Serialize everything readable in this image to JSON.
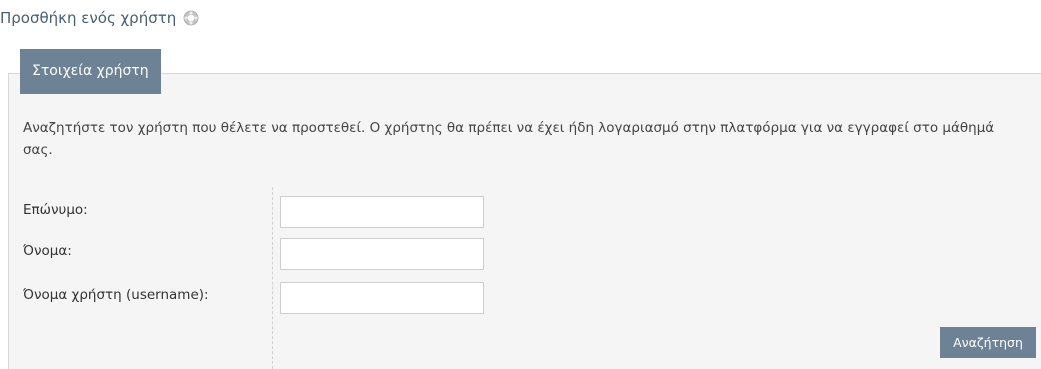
{
  "page": {
    "title": "Προσθήκη ενός χρήστη",
    "title_icon": "help-lifebuoy-icon"
  },
  "fieldset": {
    "legend": "Στοιχεία χρήστη",
    "description": "Αναζητήστε τον χρήστη που θέλετε να προστεθεί. Ο χρήστης θα πρέπει να έχει ήδη λογαριασμό στην πλατφόρμα για να εγγραφεί στο μάθημά σας."
  },
  "form": {
    "fields": [
      {
        "label": "Επώνυμο:",
        "value": ""
      },
      {
        "label": "Όνομα:",
        "value": ""
      },
      {
        "label": "Όνομα χρήστη (username):",
        "value": ""
      }
    ],
    "submit_label": "Αναζήτηση"
  },
  "colors": {
    "accent": "#6e8296",
    "title": "#4a5f70",
    "panel_bg": "#f5f5f5"
  }
}
